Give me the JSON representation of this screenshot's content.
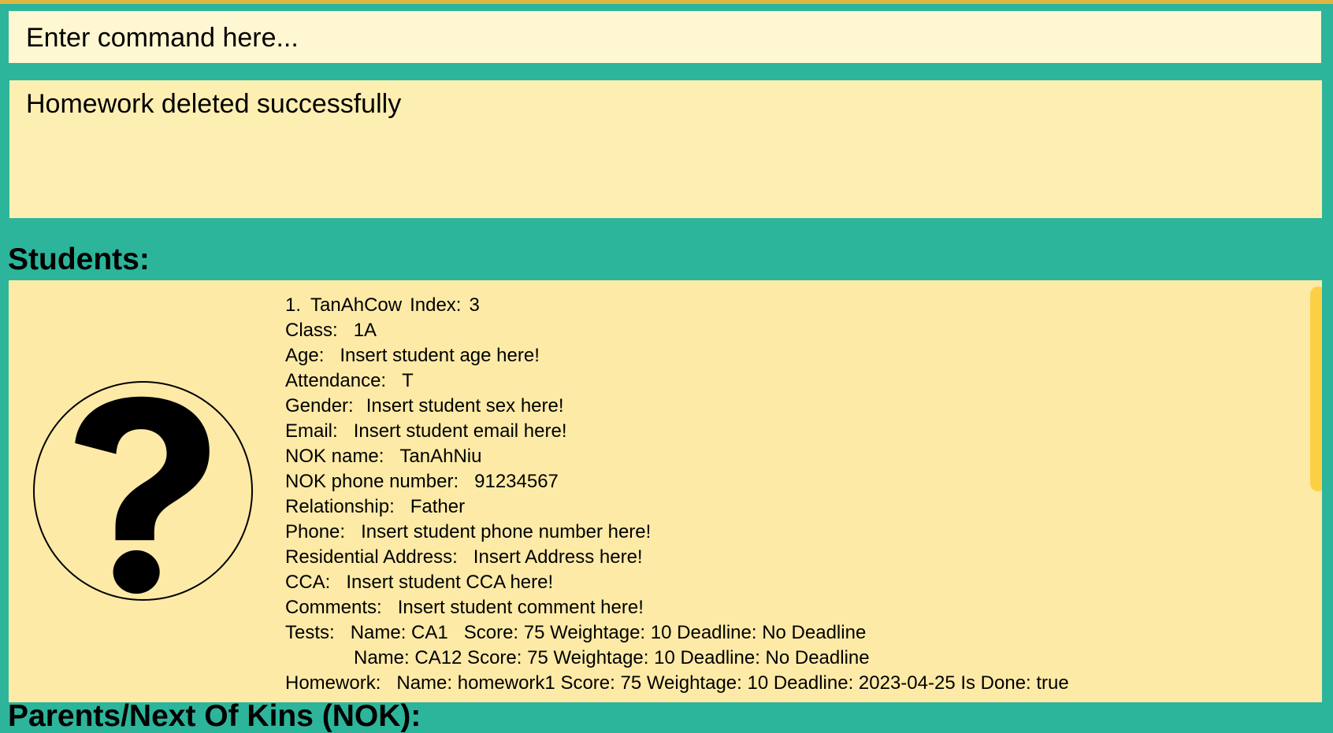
{
  "command": {
    "placeholder": "Enter command here..."
  },
  "result": {
    "message": "Homework deleted successfully"
  },
  "students_title": "Students:",
  "student": {
    "index_no": "1.",
    "name": "TanAhCow",
    "index_label": "Index:",
    "index_value": "3",
    "class_label": "Class:",
    "class_value": "1A",
    "age_label": "Age:",
    "age_value": "Insert student age here!",
    "attendance_label": "Attendance:",
    "attendance_value": "T",
    "gender_label": "Gender:",
    "gender_value": "Insert student sex here!",
    "email_label": "Email:",
    "email_value": "Insert student email here!",
    "nok_name_label": "NOK name:",
    "nok_name_value": "TanAhNiu",
    "nok_phone_label": "NOK phone number:",
    "nok_phone_value": "91234567",
    "relationship_label": "Relationship:",
    "relationship_value": "Father",
    "phone_label": "Phone:",
    "phone_value": "Insert student phone number here!",
    "address_label": "Residential Address:",
    "address_value": "Insert Address here!",
    "cca_label": "CCA:",
    "cca_value": "Insert student CCA here!",
    "comments_label": "Comments:",
    "comments_value": "Insert student comment here!",
    "tests_label": "Tests:",
    "tests": [
      "Name: CA1   Score: 75 Weightage: 10 Deadline: No Deadline",
      "Name: CA12 Score: 75 Weightage: 10 Deadline: No Deadline"
    ],
    "homework_label": "Homework:",
    "homework": [
      "Name: homework1 Score: 75 Weightage: 10 Deadline: 2023-04-25 Is Done: true"
    ]
  },
  "parents_title": "Parents/Next Of Kins (NOK):"
}
